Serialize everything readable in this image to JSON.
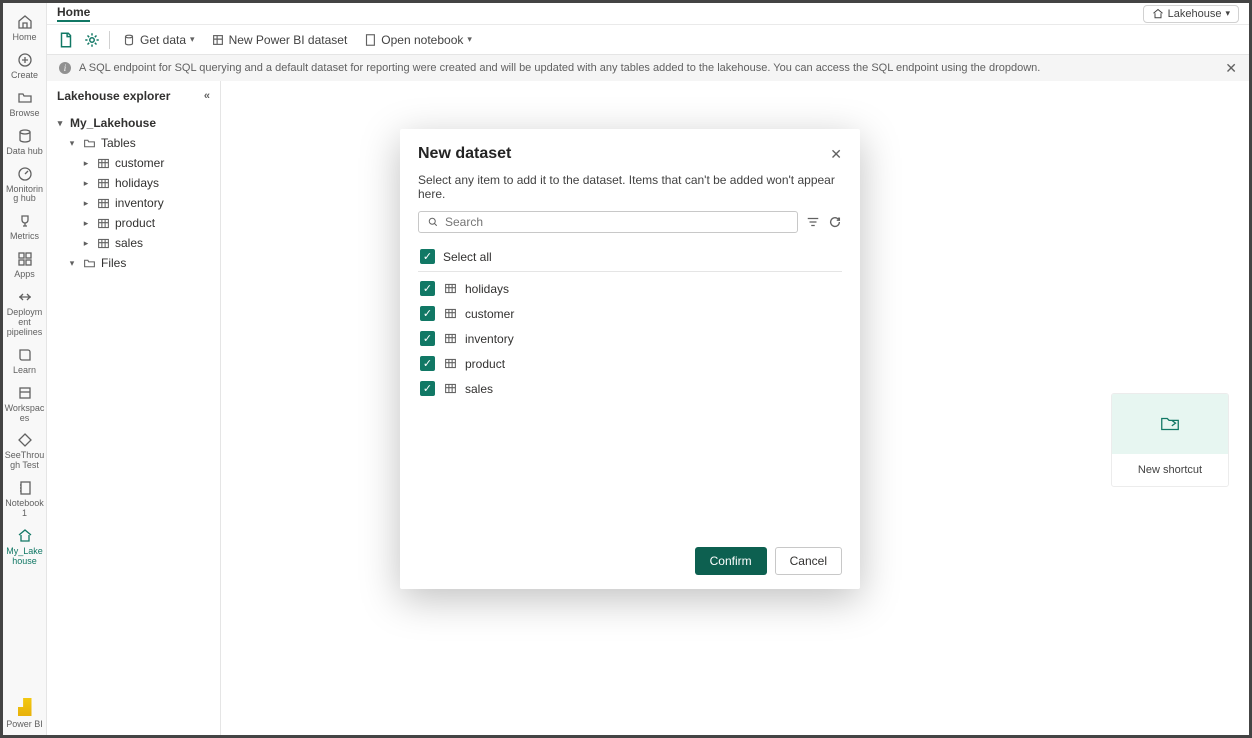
{
  "header": {
    "tab": "Home",
    "workspace_label": "Lakehouse"
  },
  "toolbar": {
    "get_data": "Get data",
    "new_dataset": "New Power BI dataset",
    "open_notebook": "Open notebook"
  },
  "banner": {
    "text": "A SQL endpoint for SQL querying and a default dataset for reporting were created and will be updated with any tables added to the lakehouse. You can access the SQL endpoint using the dropdown."
  },
  "rail": {
    "items": [
      {
        "label": "Home"
      },
      {
        "label": "Create"
      },
      {
        "label": "Browse"
      },
      {
        "label": "Data hub"
      },
      {
        "label": "Monitoring hub"
      },
      {
        "label": "Metrics"
      },
      {
        "label": "Apps"
      },
      {
        "label": "Deployment pipelines"
      },
      {
        "label": "Learn"
      },
      {
        "label": "Workspaces"
      },
      {
        "label": "SeeThrough Test"
      },
      {
        "label": "Notebook 1"
      },
      {
        "label": "My_Lakehouse"
      }
    ],
    "bottom_label": "Power BI"
  },
  "explorer": {
    "title": "Lakehouse explorer",
    "root": "My_Lakehouse",
    "tables_label": "Tables",
    "files_label": "Files",
    "tables": [
      {
        "name": "customer"
      },
      {
        "name": "holidays"
      },
      {
        "name": "inventory"
      },
      {
        "name": "product"
      },
      {
        "name": "sales"
      }
    ]
  },
  "new_shortcut": {
    "label": "New shortcut"
  },
  "modal": {
    "title": "New dataset",
    "subtitle": "Select any item to add it to the dataset. Items that can't be added won't appear here.",
    "search_placeholder": "Search",
    "select_all": "Select all",
    "items": [
      {
        "name": "holidays"
      },
      {
        "name": "customer"
      },
      {
        "name": "inventory"
      },
      {
        "name": "product"
      },
      {
        "name": "sales"
      }
    ],
    "confirm": "Confirm",
    "cancel": "Cancel"
  }
}
